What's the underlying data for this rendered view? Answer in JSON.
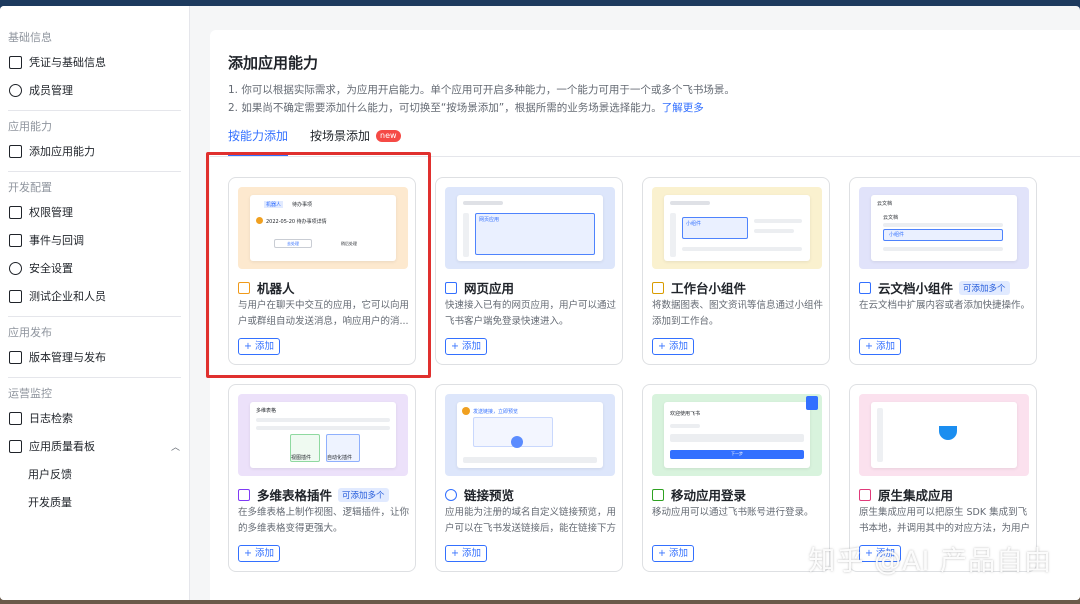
{
  "sidebar": {
    "sections": [
      {
        "title": "基础信息",
        "items": [
          {
            "label": "凭证与基础信息"
          },
          {
            "label": "成员管理"
          }
        ]
      },
      {
        "title": "应用能力",
        "items": [
          {
            "label": "添加应用能力"
          }
        ]
      },
      {
        "title": "开发配置",
        "items": [
          {
            "label": "权限管理"
          },
          {
            "label": "事件与回调"
          },
          {
            "label": "安全设置"
          },
          {
            "label": "测试企业和人员"
          }
        ]
      },
      {
        "title": "应用发布",
        "items": [
          {
            "label": "版本管理与发布"
          }
        ]
      },
      {
        "title": "运营监控",
        "items": [
          {
            "label": "日志检索"
          },
          {
            "label": "应用质量看板"
          },
          {
            "label": "用户反馈"
          },
          {
            "label": "开发质量"
          }
        ]
      }
    ]
  },
  "main": {
    "title": "添加应用能力",
    "desc1": "1. 你可以根据实际需求，为应用开启能力。单个应用可开启多种能力，一个能力可用于一个或多个飞书场景。",
    "desc2": "2. 如果尚不确定需要添加什么能力，可切换至“按场景添加”，根据所需的业务场景选择能力。",
    "learn_more": "了解更多",
    "tabs": [
      {
        "label": "按能力添加"
      },
      {
        "label": "按场景添加"
      }
    ],
    "new_badge": "new",
    "add_label": "+ 添加",
    "cards": [
      {
        "title": "机器人",
        "desc": "与用户在聊天中交互的应用，它可以向用户或群组自动发送消息，响应用户的消...",
        "tag": "",
        "thumb": {
          "t1": "待办事项",
          "t2": "2022-05-20 待办事项详情",
          "b1": "去处理",
          "b2": "稍后处理"
        }
      },
      {
        "title": "网页应用",
        "desc": "快速接入已有的网页应用，用户可以通过飞书客户端免登录快速进入。",
        "tag": "",
        "thumb": {
          "t1": "网页应用"
        }
      },
      {
        "title": "工作台小组件",
        "desc": "将数据图表、图文资讯等信息通过小组件添加到工作台。",
        "tag": "",
        "thumb": {
          "t1": "小组件"
        }
      },
      {
        "title": "云文档小组件",
        "desc": "在云文档中扩展内容或者添加快捷操作。",
        "tag": "可添加多个",
        "thumb": {
          "t1": "云文档",
          "t2": "小组件"
        }
      },
      {
        "title": "多维表格插件",
        "desc": "在多维表格上制作视图、逻辑插件，让你的多维表格变得更强大。",
        "tag": "可添加多个",
        "thumb": {
          "t1": "多维表格",
          "b1": "视图插件",
          "b2": "自动化插件"
        }
      },
      {
        "title": "链接预览",
        "desc": "应用能为注册的域名自定义链接预览，用户可以在飞书发送链接后，能在链接下方展示...",
        "tag": "",
        "thumb": {
          "t1": "发送链接，立即预览"
        }
      },
      {
        "title": "移动应用登录",
        "desc": "移动应用可以通过飞书账号进行登录。",
        "tag": "",
        "thumb": {
          "t1": "欢迎使用飞书",
          "b1": "下一步"
        }
      },
      {
        "title": "原生集成应用",
        "desc": "原生集成应用可以把原生 SDK 集成到飞书本地，并调用其中的对应方法，为用户提...",
        "tag": "",
        "thumb": {}
      }
    ]
  },
  "watermark": "知乎 @AI 产品自由",
  "colors": {
    "accent": "#3370ff",
    "highlight": "#e0302e"
  }
}
